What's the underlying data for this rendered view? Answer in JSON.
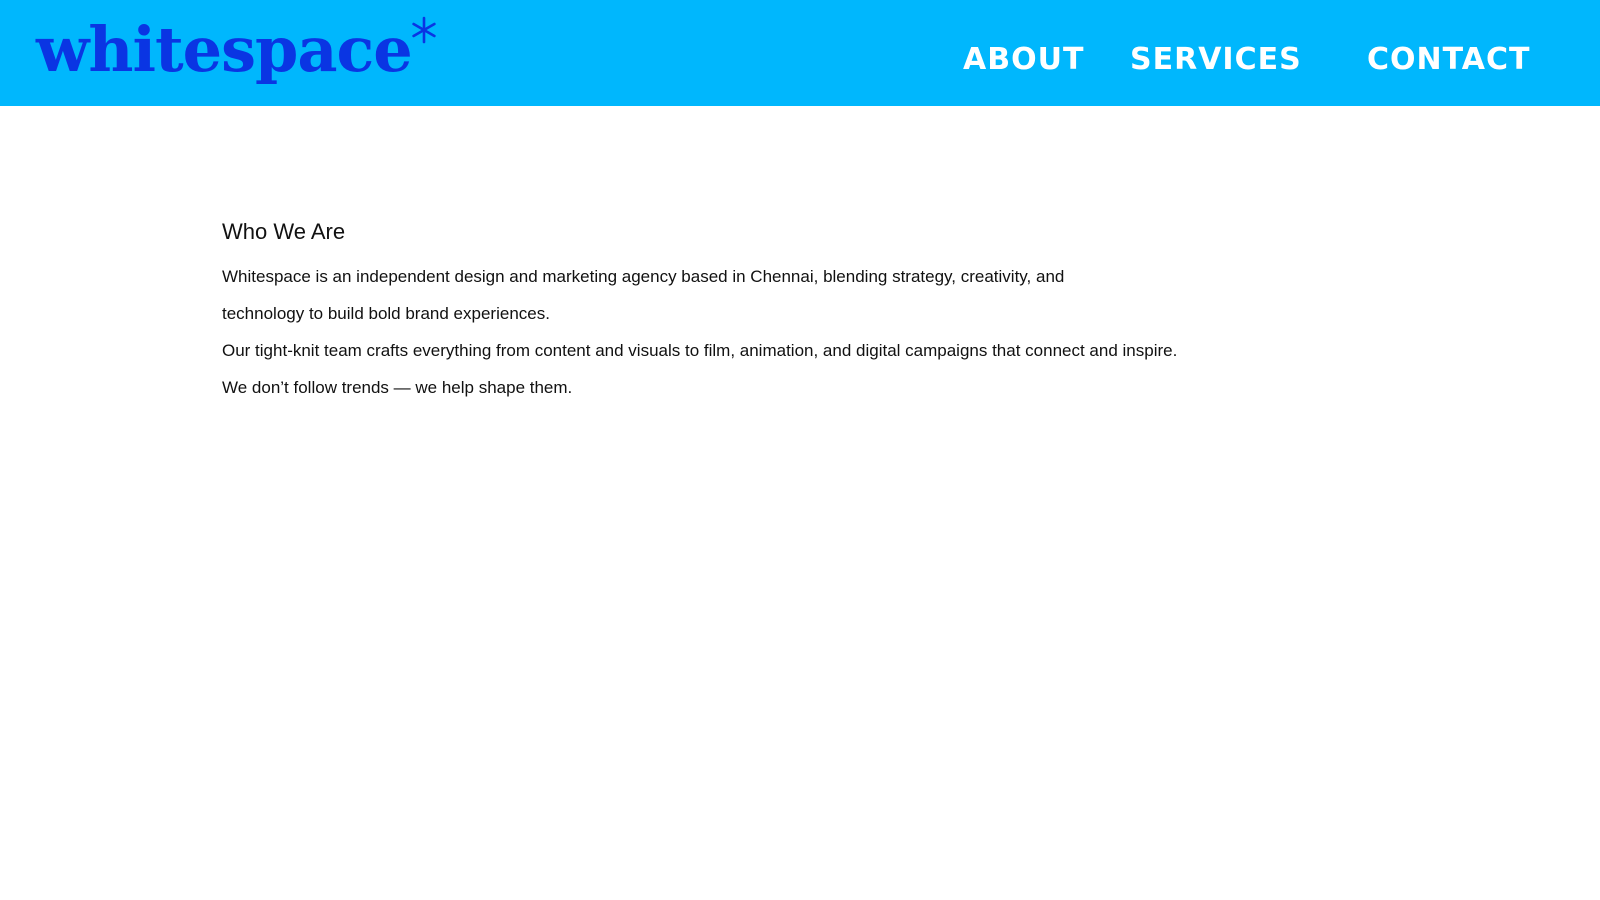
{
  "header": {
    "logo_text": "whitespace",
    "logo_mark": "asterisk-icon",
    "background_color": "#00b7fd",
    "logo_color": "#0a35e3"
  },
  "nav": {
    "items": [
      {
        "label": "ABOUT"
      },
      {
        "label": "SERVICES"
      },
      {
        "label": "CONTACT"
      }
    ]
  },
  "main": {
    "heading": "Who We Are",
    "lines": [
      "Whitespace is an independent design and marketing agency based in Chennai, blending strategy, creativity, and",
      "technology to build bold brand experiences.",
      "Our tight-knit team crafts everything from content and visuals to film, animation, and digital campaigns that connect and inspire.",
      "We don’t follow trends — we help shape them."
    ]
  }
}
